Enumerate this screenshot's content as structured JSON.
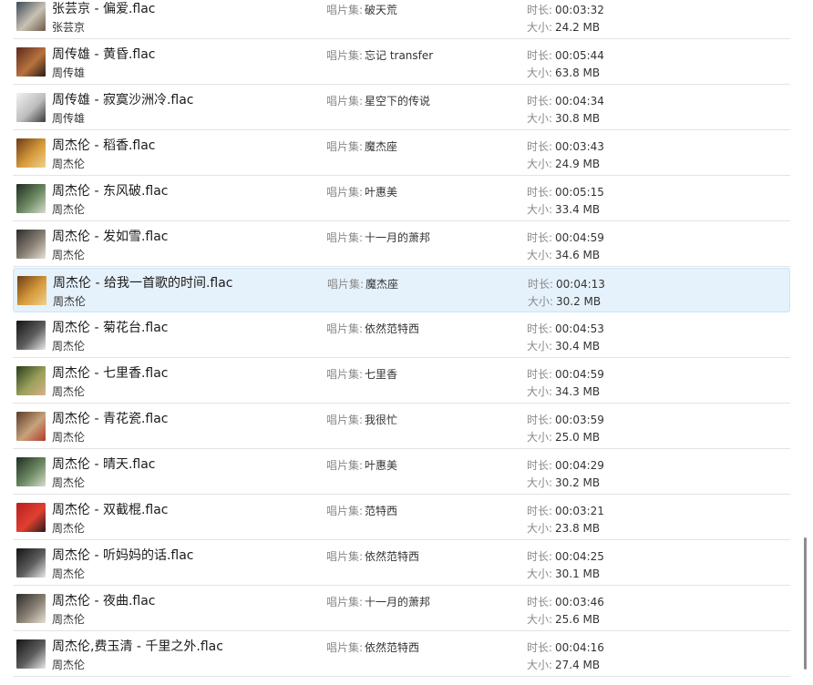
{
  "labels": {
    "album": "唱片集:",
    "duration": "时长:",
    "size": "大小:"
  },
  "tracks": [
    {
      "title": "张芸京 - 偏爱.flac",
      "artist": "张芸京",
      "album": "破天荒",
      "duration": "00:03:32",
      "size": "24.2 MB",
      "cover_icon": "album-cover-icon",
      "cover_colors": [
        "#3b4a55",
        "#c9c2b4",
        "#6c5a48"
      ]
    },
    {
      "title": "周传雄 - 黄昏.flac",
      "artist": "周传雄",
      "album": "忘记 transfer",
      "duration": "00:05:44",
      "size": "63.8 MB",
      "cover_icon": "album-cover-icon",
      "cover_colors": [
        "#5a2a1c",
        "#b8733f",
        "#2a1a14"
      ]
    },
    {
      "title": "周传雄 - 寂寞沙洲冷.flac",
      "artist": "周传雄",
      "album": "星空下的传说",
      "duration": "00:04:34",
      "size": "30.8 MB",
      "cover_icon": "album-cover-icon",
      "cover_colors": [
        "#f2f2f2",
        "#bdbdbd",
        "#3a3a3a"
      ]
    },
    {
      "title": "周杰伦 - 稻香.flac",
      "artist": "周杰伦",
      "album": "魔杰座",
      "duration": "00:03:43",
      "size": "24.9 MB",
      "cover_icon": "album-cover-icon",
      "cover_colors": [
        "#6e3b16",
        "#d69b3c",
        "#f1d18a"
      ]
    },
    {
      "title": "周杰伦 - 东风破.flac",
      "artist": "周杰伦",
      "album": "叶惠美",
      "duration": "00:05:15",
      "size": "33.4 MB",
      "cover_icon": "album-cover-icon",
      "cover_colors": [
        "#1f2d22",
        "#6d8a63",
        "#d8dccb"
      ]
    },
    {
      "title": "周杰伦 - 发如雪.flac",
      "artist": "周杰伦",
      "album": "十一月的萧邦",
      "duration": "00:04:59",
      "size": "34.6 MB",
      "cover_icon": "album-cover-icon",
      "cover_colors": [
        "#2b2b2b",
        "#8a8175",
        "#e6e0d4"
      ]
    },
    {
      "title": "周杰伦 - 给我一首歌的时间.flac",
      "artist": "周杰伦",
      "album": "魔杰座",
      "duration": "00:04:13",
      "size": "30.2 MB",
      "cover_icon": "album-cover-icon",
      "cover_colors": [
        "#6e3b16",
        "#d69b3c",
        "#f1d18a"
      ],
      "selected": true
    },
    {
      "title": "周杰伦 - 菊花台.flac",
      "artist": "周杰伦",
      "album": "依然范特西",
      "duration": "00:04:53",
      "size": "30.4 MB",
      "cover_icon": "album-cover-icon",
      "cover_colors": [
        "#141414",
        "#5e5e5e",
        "#e9e9e9"
      ]
    },
    {
      "title": "周杰伦 - 七里香.flac",
      "artist": "周杰伦",
      "album": "七里香",
      "duration": "00:04:59",
      "size": "34.3 MB",
      "cover_icon": "album-cover-icon",
      "cover_colors": [
        "#2a3d1c",
        "#9aa05a",
        "#d9b08c"
      ]
    },
    {
      "title": "周杰伦 - 青花瓷.flac",
      "artist": "周杰伦",
      "album": "我很忙",
      "duration": "00:03:59",
      "size": "25.0 MB",
      "cover_icon": "album-cover-icon",
      "cover_colors": [
        "#5c3b28",
        "#c8a27c",
        "#b23a2a"
      ]
    },
    {
      "title": "周杰伦 - 晴天.flac",
      "artist": "周杰伦",
      "album": "叶惠美",
      "duration": "00:04:29",
      "size": "30.2 MB",
      "cover_icon": "album-cover-icon",
      "cover_colors": [
        "#1f2d22",
        "#6d8a63",
        "#d8dccb"
      ]
    },
    {
      "title": "周杰伦 - 双截棍.flac",
      "artist": "周杰伦",
      "album": "范特西",
      "duration": "00:03:21",
      "size": "23.8 MB",
      "cover_icon": "album-cover-icon",
      "cover_colors": [
        "#b81f1f",
        "#e04030",
        "#2a1a1a"
      ]
    },
    {
      "title": "周杰伦 - 听妈妈的话.flac",
      "artist": "周杰伦",
      "album": "依然范特西",
      "duration": "00:04:25",
      "size": "30.1 MB",
      "cover_icon": "album-cover-icon",
      "cover_colors": [
        "#141414",
        "#5e5e5e",
        "#e9e9e9"
      ]
    },
    {
      "title": "周杰伦 - 夜曲.flac",
      "artist": "周杰伦",
      "album": "十一月的萧邦",
      "duration": "00:03:46",
      "size": "25.6 MB",
      "cover_icon": "album-cover-icon",
      "cover_colors": [
        "#2b2b2b",
        "#8a8175",
        "#e6e0d4"
      ]
    },
    {
      "title": "周杰伦,费玉清 - 千里之外.flac",
      "artist": "周杰伦",
      "album": "依然范特西",
      "duration": "00:04:16",
      "size": "27.4 MB",
      "cover_icon": "album-cover-icon",
      "cover_colors": [
        "#141414",
        "#5e5e5e",
        "#e9e9e9"
      ]
    }
  ],
  "scrollbar_icon": "scrollbar-thumb"
}
